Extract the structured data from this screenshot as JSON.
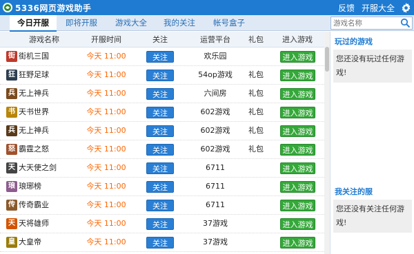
{
  "app": {
    "title": "5336网页游戏助手",
    "links": [
      "反馈",
      "开服大全"
    ]
  },
  "tabs": [
    {
      "label": "今日开服",
      "active": true
    },
    {
      "label": "即将开服",
      "active": false
    },
    {
      "label": "游戏大全",
      "active": false
    },
    {
      "label": "我的关注",
      "active": false
    },
    {
      "label": "帐号盒子",
      "active": false
    }
  ],
  "search": {
    "placeholder": "游戏名称"
  },
  "table": {
    "headers": [
      "游戏名称",
      "开服时间",
      "关注",
      "运营平台",
      "礼包",
      "进入游戏"
    ],
    "follow_label": "关注",
    "enter_label": "进入游戏",
    "rows": [
      {
        "icon": "街",
        "icon_color": "#c0392b",
        "name": "街机三国",
        "time": "今天  11:00",
        "platform": "欢乐园",
        "gift": ""
      },
      {
        "icon": "狂",
        "icon_color": "#2c3e50",
        "name": "狂野足球",
        "time": "今天  11:00",
        "platform": "54op游戏",
        "gift": "礼包"
      },
      {
        "icon": "兵",
        "icon_color": "#7b4a1e",
        "name": "无上神兵",
        "time": "今天  11:00",
        "platform": "六间房",
        "gift": "礼包"
      },
      {
        "icon": "书",
        "icon_color": "#b8860b",
        "name": "天书世界",
        "time": "今天  11:00",
        "platform": "602游戏",
        "gift": "礼包"
      },
      {
        "icon": "兵",
        "icon_color": "#5a3a1a",
        "name": "无上神兵",
        "time": "今天  11:00",
        "platform": "602游戏",
        "gift": "礼包"
      },
      {
        "icon": "怒",
        "icon_color": "#a0522d",
        "name": "霸霆之怒",
        "time": "今天  11:00",
        "platform": "602游戏",
        "gift": "礼包"
      },
      {
        "icon": "天",
        "icon_color": "#444444",
        "name": "大天使之剑",
        "time": "今天  11:00",
        "platform": "6711",
        "gift": ""
      },
      {
        "icon": "琅",
        "icon_color": "#8e5c8e",
        "name": "琅琊榜",
        "time": "今天  11:00",
        "platform": "6711",
        "gift": ""
      },
      {
        "icon": "传",
        "icon_color": "#8b5a2b",
        "name": "传奇霸业",
        "time": "今天  11:00",
        "platform": "6711",
        "gift": ""
      },
      {
        "icon": "天",
        "icon_color": "#d35400",
        "name": "天将雄师",
        "time": "今天  11:00",
        "platform": "37游戏",
        "gift": ""
      },
      {
        "icon": "皇",
        "icon_color": "#9a7d0a",
        "name": "大皇帝",
        "time": "今天  11:00",
        "platform": "37游戏",
        "gift": ""
      }
    ]
  },
  "sidebar": {
    "played_title": "玩过的游戏",
    "played_empty": "您还没有玩过任何游戏!",
    "followed_title": "我关注的服",
    "followed_empty": "您还没有关注任何游戏!"
  }
}
